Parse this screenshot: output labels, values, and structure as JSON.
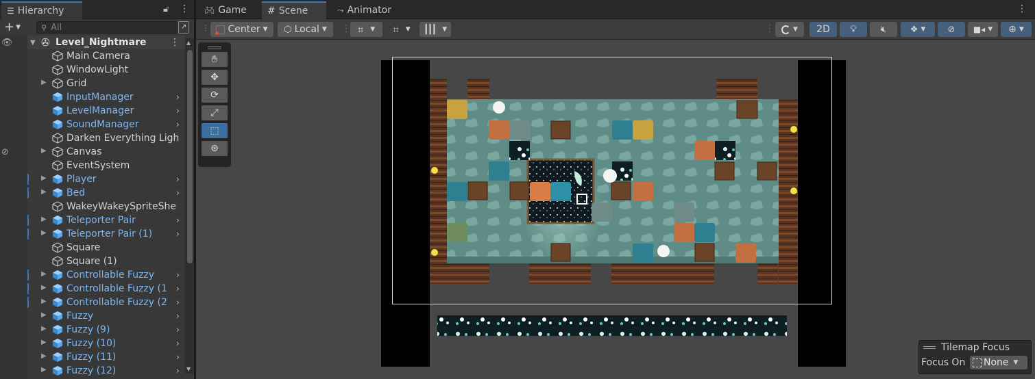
{
  "hierarchy": {
    "tab_label": "Hierarchy",
    "search_placeholder": "All",
    "scene_name": "Level_Nightmare",
    "items": [
      {
        "label": "Main Camera",
        "prefab": false,
        "foldout": false,
        "arrow": false
      },
      {
        "label": "WindowLight",
        "prefab": false,
        "foldout": false,
        "arrow": false
      },
      {
        "label": "Grid",
        "prefab": false,
        "foldout": true,
        "arrow": false
      },
      {
        "label": "InputManager",
        "prefab": true,
        "foldout": false,
        "arrow": true
      },
      {
        "label": "LevelManager",
        "prefab": true,
        "foldout": false,
        "arrow": true
      },
      {
        "label": "SoundManager",
        "prefab": true,
        "foldout": false,
        "arrow": true
      },
      {
        "label": "Darken Everything Ligh",
        "prefab": false,
        "foldout": false,
        "arrow": false
      },
      {
        "label": "Canvas",
        "prefab": false,
        "foldout": true,
        "arrow": false
      },
      {
        "label": "EventSystem",
        "prefab": false,
        "foldout": false,
        "arrow": false
      },
      {
        "label": "Player",
        "prefab": true,
        "foldout": true,
        "arrow": true
      },
      {
        "label": "Bed",
        "prefab": true,
        "foldout": true,
        "arrow": true
      },
      {
        "label": "WakeyWakeySpriteShe",
        "prefab": false,
        "foldout": false,
        "arrow": false
      },
      {
        "label": "Teleporter Pair",
        "prefab": true,
        "foldout": true,
        "arrow": true
      },
      {
        "label": "Teleporter Pair (1)",
        "prefab": true,
        "foldout": true,
        "arrow": true
      },
      {
        "label": "Square",
        "prefab": false,
        "foldout": false,
        "arrow": false
      },
      {
        "label": "Square (1)",
        "prefab": false,
        "foldout": false,
        "arrow": false
      },
      {
        "label": "Controllable Fuzzy",
        "prefab": true,
        "foldout": true,
        "arrow": true
      },
      {
        "label": "Controllable Fuzzy (1",
        "prefab": true,
        "foldout": true,
        "arrow": true
      },
      {
        "label": "Controllable Fuzzy (2",
        "prefab": true,
        "foldout": true,
        "arrow": true
      },
      {
        "label": "Fuzzy",
        "prefab": true,
        "foldout": true,
        "arrow": true
      },
      {
        "label": "Fuzzy (9)",
        "prefab": true,
        "foldout": true,
        "arrow": true
      },
      {
        "label": "Fuzzy (10)",
        "prefab": true,
        "foldout": true,
        "arrow": true
      },
      {
        "label": "Fuzzy (11)",
        "prefab": true,
        "foldout": true,
        "arrow": true
      },
      {
        "label": "Fuzzy (12)",
        "prefab": true,
        "foldout": true,
        "arrow": true
      }
    ]
  },
  "tabs": {
    "game": "Game",
    "scene": "Scene",
    "animator": "Animator"
  },
  "toolbar": {
    "pivot": "Center",
    "space": "Local",
    "mode_2d": "2D"
  },
  "tilemap_focus": {
    "title": "Tilemap Focus",
    "focus_on_label": "Focus On",
    "focus_value": "None"
  },
  "colors": {
    "accent": "#3a79bb",
    "prefab_text": "#7cb7f5",
    "panel": "#383838",
    "scene_bg": "#474747"
  }
}
